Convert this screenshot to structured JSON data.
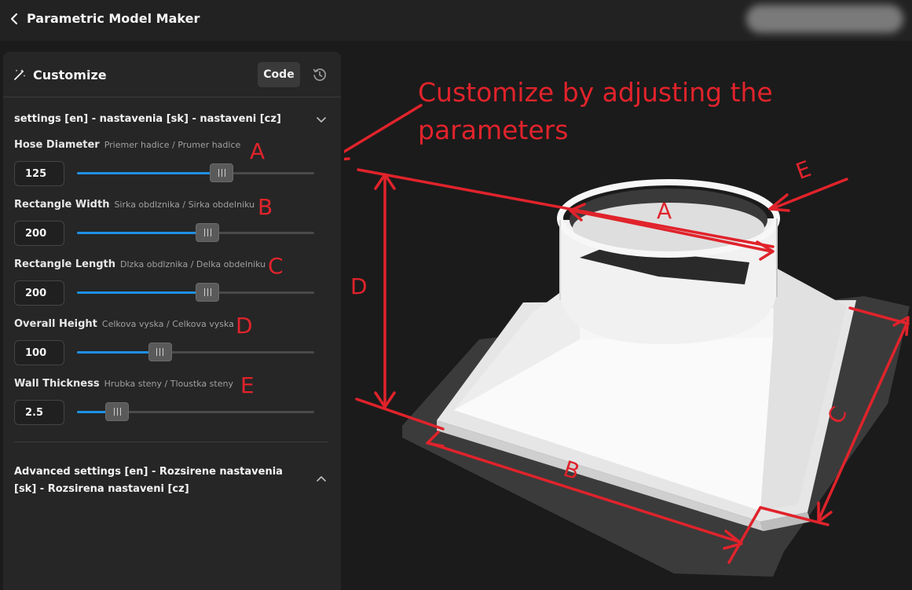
{
  "app": {
    "title": "Parametric Model Maker"
  },
  "panel": {
    "title": "Customize",
    "code_label": "Code",
    "section_title": "settings [en] - nastavenia [sk] - nastaveni [cz]",
    "params": [
      {
        "label": "Hose Diameter",
        "sub": "Priemer hadice / Prumer hadice",
        "value": "125",
        "slider_fraction": 0.61
      },
      {
        "label": "Rectangle Width",
        "sub": "Sirka obdlznika / Sirka obdelniku",
        "value": "200",
        "slider_fraction": 0.55
      },
      {
        "label": "Rectangle Length",
        "sub": "Dlzka obdlznika / Delka obdelniku",
        "value": "200",
        "slider_fraction": 0.55
      },
      {
        "label": "Overall Height",
        "sub": "Celkova vyska / Celkova vyska",
        "value": "100",
        "slider_fraction": 0.35
      },
      {
        "label": "Wall Thickness",
        "sub": "Hrubka steny / Tloustka steny",
        "value": "2.5",
        "slider_fraction": 0.17
      }
    ],
    "advanced_title": "Advanced settings [en] - Rozsirene nastavenia [sk] - Rozsirena nastaveni [cz]"
  },
  "annotations": {
    "caption": "Customize by adjusting the parameters",
    "letters": [
      "A",
      "B",
      "C",
      "D",
      "E"
    ]
  },
  "colors": {
    "accent": "#1e90e6",
    "annotation": "#e0232b",
    "panel": "#262626",
    "background": "#1b1b1b"
  }
}
